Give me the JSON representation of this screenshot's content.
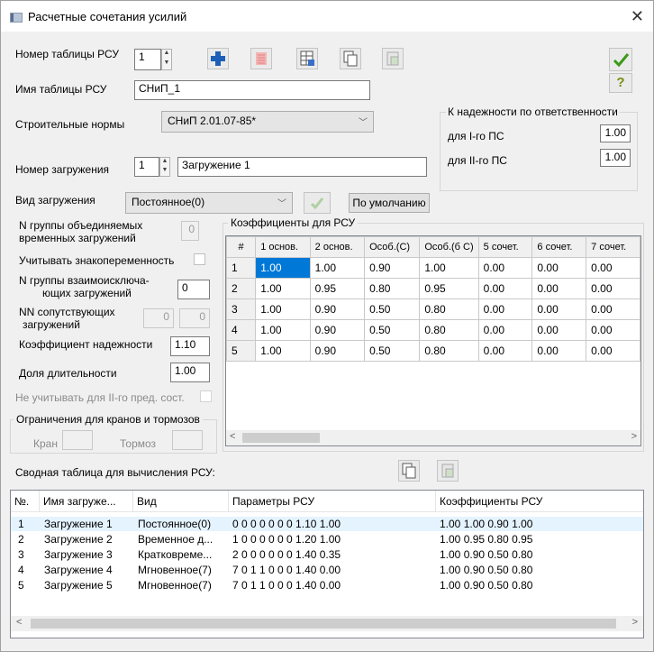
{
  "window": {
    "title": "Расчетные сочетания усилий"
  },
  "rsu": {
    "table_number_label": "Номер таблицы РСУ",
    "table_number_value": "1",
    "table_name_label": "Имя таблицы РСУ",
    "table_name_value": "СНиП_1",
    "norms_label": "Строительные нормы",
    "norms_value": "СНиП 2.01.07-85*",
    "loading_number_label": "Номер загружения",
    "loading_number_value": "1",
    "loading_name_value": "Загружение 1",
    "loading_type_label": "Вид загружения",
    "loading_type_value": "Постоянное(0)",
    "default_button": "По умолчанию"
  },
  "reliability": {
    "title": "К надежности по ответственности",
    "group1_label": "для I-го ПС",
    "group1_value": "1.00",
    "group2_label": "для II-го ПС",
    "group2_value": "1.00"
  },
  "params": {
    "n_group_temp_label_1": "N группы объединяемых",
    "n_group_temp_label_2": "временных загружений",
    "n_group_temp_value": "0",
    "alternating_label": "Учитывать знакопеременность",
    "n_group_exclusive_label_1": "N группы взаимоисключа-",
    "n_group_exclusive_label_2": "ющих загружений",
    "n_group_exclusive_value": "0",
    "nn_accomp_label_1": "NN сопутствующих",
    "nn_accomp_label_2": "загружений",
    "nn_accomp_value_1": "0",
    "nn_accomp_value_2": "0",
    "reliability_coef_label": "Коэффициент надежности",
    "reliability_coef_value": "1.10",
    "duration_label": "Доля длительности",
    "duration_value": "1.00",
    "ignore_ii_label": "Не учитывать для II-го пред. сост.",
    "crane_group_title": "Ограничения для кранов и тормозов",
    "crane_label": "Кран",
    "brake_label": "Тормоз"
  },
  "coef_table": {
    "title": "Коэффициенты для РСУ",
    "headers": [
      "#",
      "1 основ.",
      "2 основ.",
      "Особ.(С)",
      "Особ.(б С)",
      "5 сочет.",
      "6 сочет.",
      "7 сочет."
    ],
    "rows": [
      [
        "1",
        "1.00",
        "1.00",
        "0.90",
        "1.00",
        "0.00",
        "0.00",
        "0.00"
      ],
      [
        "2",
        "1.00",
        "0.95",
        "0.80",
        "0.95",
        "0.00",
        "0.00",
        "0.00"
      ],
      [
        "3",
        "1.00",
        "0.90",
        "0.50",
        "0.80",
        "0.00",
        "0.00",
        "0.00"
      ],
      [
        "4",
        "1.00",
        "0.90",
        "0.50",
        "0.80",
        "0.00",
        "0.00",
        "0.00"
      ],
      [
        "5",
        "1.00",
        "0.90",
        "0.50",
        "0.80",
        "0.00",
        "0.00",
        "0.00"
      ]
    ]
  },
  "summary": {
    "title": "Сводная таблица для вычисления РСУ:",
    "headers": [
      "№.",
      "Имя загруже...",
      "Вид",
      "Параметры РСУ",
      "Коэффициенты РСУ"
    ],
    "rows": [
      [
        "1",
        "Загружение 1",
        "Постоянное(0)",
        "0 0 0 0 0 0 0 1.10 1.00",
        "1.00 1.00 0.90 1.00"
      ],
      [
        "2",
        "Загружение 2",
        "Временное д...",
        "1 0 0 0 0 0 0 1.20 1.00",
        "1.00 0.95 0.80 0.95"
      ],
      [
        "3",
        "Загружение 3",
        "Кратковреме...",
        "2 0 0 0 0 0 0 1.40 0.35",
        "1.00 0.90 0.50 0.80"
      ],
      [
        "4",
        "Загружение 4",
        "Мгновенное(7)",
        "7 0 1 1 0 0 0 1.40 0.00",
        "1.00 0.90 0.50 0.80"
      ],
      [
        "5",
        "Загружение 5",
        "Мгновенное(7)",
        "7 0 1 1 0 0 0 1.40 0.00",
        "1.00 0.90 0.50 0.80"
      ]
    ]
  },
  "colors": {
    "accent": "#0078d7",
    "ok_green": "#3a9a1a",
    "help_olive": "#7a8a10",
    "add_blue": "#1d5fb8",
    "delete_red": "#e03030"
  }
}
